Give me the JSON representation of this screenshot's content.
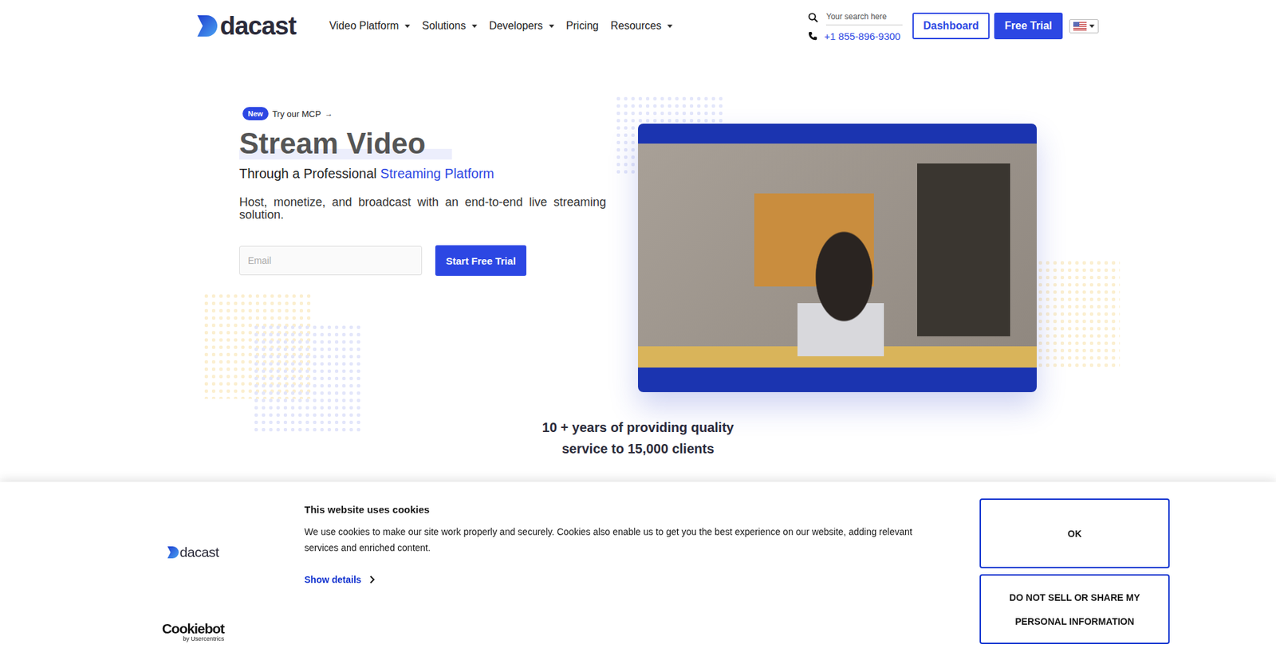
{
  "header": {
    "logo": "dacast",
    "nav": [
      {
        "label": "Video Platform",
        "dropdown": true
      },
      {
        "label": "Solutions",
        "dropdown": true
      },
      {
        "label": "Developers",
        "dropdown": true
      },
      {
        "label": "Pricing",
        "dropdown": false
      },
      {
        "label": "Resources",
        "dropdown": true
      }
    ],
    "search": {
      "placeholder": "Your search here"
    },
    "phone": "+1 855-896-9300",
    "buttons": [
      "Dashboard",
      "Free Trial"
    ]
  },
  "hero": {
    "badge": "New",
    "badge_link": "Try our MCP",
    "badge_arrow": "→",
    "title": "Stream Video",
    "subtitle": "Through a Professional",
    "subtitle_highlight": "Streaming Platform",
    "description": "Host, monetize, and broadcast with an end-to-end live streaming solution.",
    "email_placeholder": "Email",
    "cta": "Start Free Trial"
  },
  "stats": [
    "10 + years of providing quality",
    "service to 15,000 clients"
  ],
  "cookie_banner": {
    "logo": "dacast",
    "title": "This website uses cookies",
    "body": "We use cookies to make our site work properly and securely. Cookies also enable us to get you the best experience on our website, adding relevant services and enriched content.",
    "show_details": "Show details",
    "buttons": [
      "OK",
      "DO NOT SELL OR SHARE MY PERSONAL INFORMATION"
    ],
    "provider": "Cookiebot",
    "provider_by": "by Usercentrics"
  }
}
